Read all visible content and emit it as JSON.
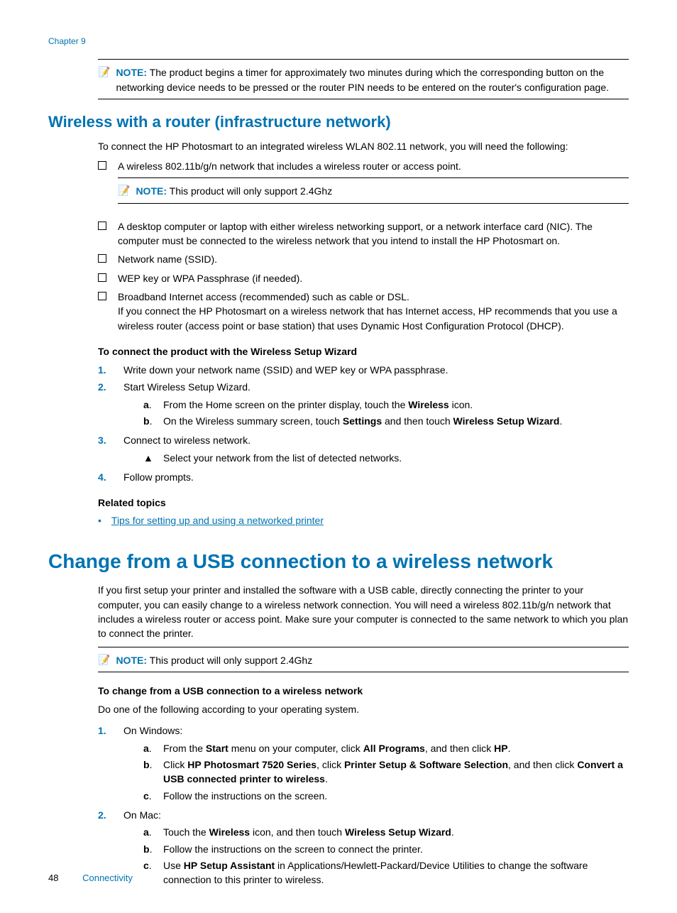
{
  "chapter": "Chapter 9",
  "note1": {
    "label": "NOTE:",
    "text": "The product begins a timer for approximately two minutes during which the corresponding button on the networking device needs to be pressed or the router PIN needs to be entered on the router's configuration page."
  },
  "section1": {
    "heading": "Wireless with a router (infrastructure network)",
    "intro": "To connect the HP Photosmart to an integrated wireless WLAN 802.11 network, you will need the following:",
    "check1": "A wireless 802.11b/g/n network that includes a wireless router or access point.",
    "note_inner": {
      "label": "NOTE:",
      "text": "This product will only support 2.4Ghz"
    },
    "check2": "A desktop computer or laptop with either wireless networking support, or a network interface card (NIC). The computer must be connected to the wireless network that you intend to install the HP Photosmart on.",
    "check3": "Network name (SSID).",
    "check4": "WEP key or WPA Passphrase (if needed).",
    "check5": "Broadband Internet access (recommended) such as cable or DSL.",
    "check5b": "If you connect the HP Photosmart on a wireless network that has Internet access, HP recommends that you use a wireless router (access point or base station) that uses Dynamic Host Configuration Protocol (DHCP).",
    "sub1": "To connect the product with the Wireless Setup Wizard",
    "step1": "Write down your network name (SSID) and WEP key or WPA passphrase.",
    "step2": "Start Wireless Setup Wizard.",
    "step2a_pre": "From the Home screen on the printer display, touch the ",
    "step2a_b1": "Wireless",
    "step2a_post": " icon.",
    "step2b_pre": "On the Wireless summary screen, touch ",
    "step2b_b1": "Settings",
    "step2b_mid": " and then touch ",
    "step2b_b2": "Wireless Setup Wizard",
    "step2b_post": ".",
    "step3": "Connect to wireless network.",
    "step3tri": "Select your network from the list of detected networks.",
    "step4": "Follow prompts.",
    "rel_heading": "Related topics",
    "rel_link": "Tips for setting up and using a networked printer"
  },
  "section2": {
    "heading": "Change from a USB connection to a wireless network",
    "intro": "If you first setup your printer and installed the software with a USB cable, directly connecting the printer to your computer, you can easily change to a wireless network connection. You will need a wireless 802.11b/g/n network that includes a wireless router or access point. Make sure your computer is connected to the same network to which you plan to connect the printer.",
    "note": {
      "label": "NOTE:",
      "text": "This product will only support 2.4Ghz"
    },
    "sub": "To change from a USB connection to a wireless network",
    "para": "Do one of the following according to your operating system.",
    "step1": "On Windows:",
    "step1a_pre": "From the ",
    "step1a_b1": "Start",
    "step1a_mid1": " menu on your computer, click ",
    "step1a_b2": "All Programs",
    "step1a_mid2": ", and then click ",
    "step1a_b3": "HP",
    "step1a_post": ".",
    "step1b_pre": "Click ",
    "step1b_b1": "HP Photosmart 7520 Series",
    "step1b_mid1": ", click ",
    "step1b_b2": "Printer Setup & Software Selection",
    "step1b_mid2": ", and then click ",
    "step1b_b3": "Convert a USB connected printer to wireless",
    "step1b_post": ".",
    "step1c": "Follow the instructions on the screen.",
    "step2": "On Mac:",
    "step2a_pre": "Touch the ",
    "step2a_b1": "Wireless",
    "step2a_mid": " icon, and then touch ",
    "step2a_b2": "Wireless Setup Wizard",
    "step2a_post": ".",
    "step2b": "Follow the instructions on the screen to connect the printer.",
    "step2c_pre": "Use ",
    "step2c_b1": "HP Setup Assistant",
    "step2c_post": " in Applications/Hewlett-Packard/Device Utilities to change the software connection to this printer to wireless."
  },
  "footer": {
    "page": "48",
    "title": "Connectivity"
  }
}
